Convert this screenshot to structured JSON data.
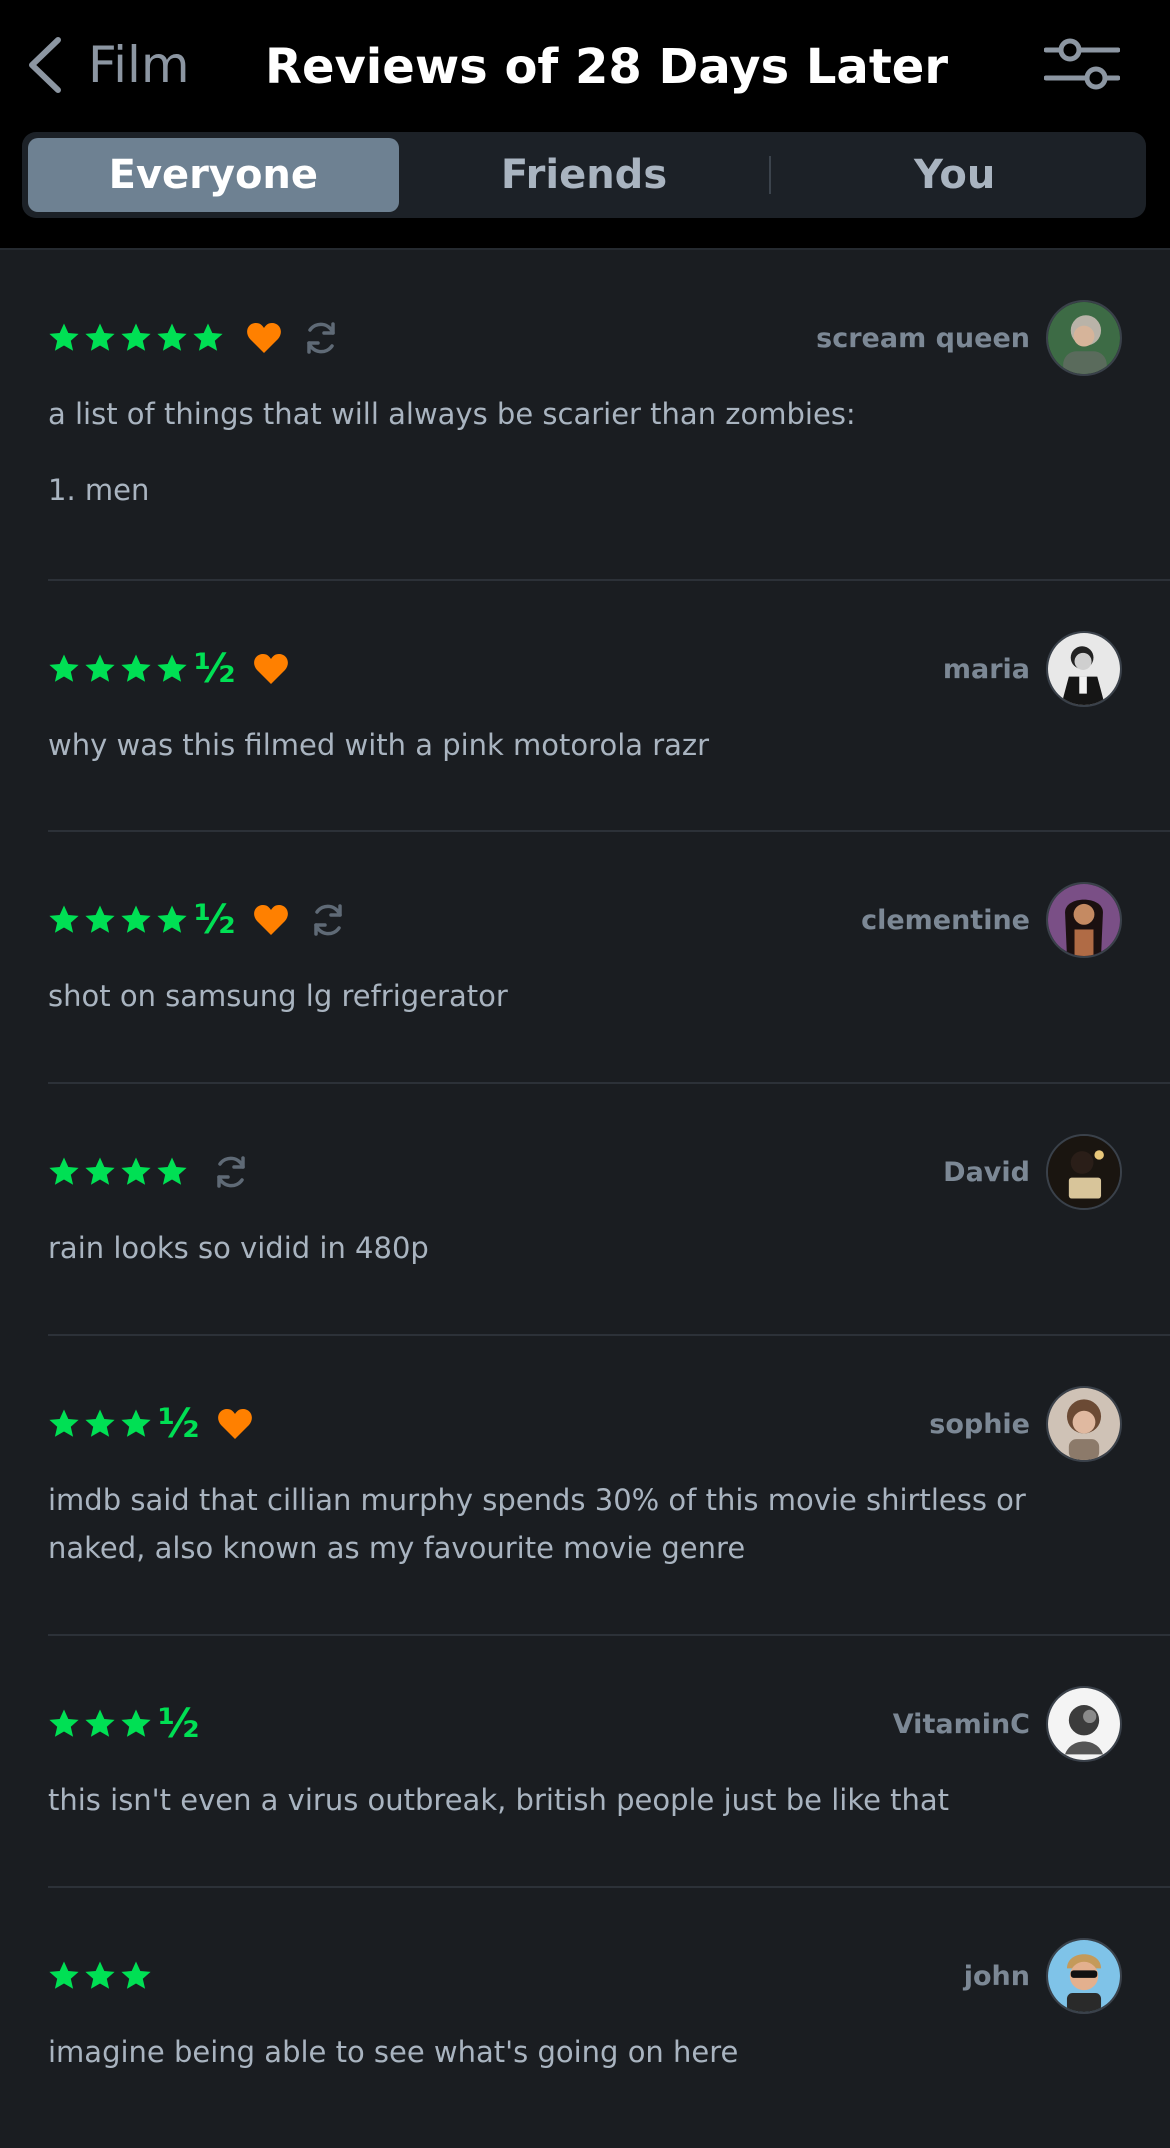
{
  "header": {
    "back_label": "Film",
    "title": "Reviews of 28 Days Later"
  },
  "tabs": [
    {
      "label": "Everyone",
      "active": true
    },
    {
      "label": "Friends",
      "active": false
    },
    {
      "label": "You",
      "active": false
    }
  ],
  "colors": {
    "star": "#00e054",
    "heart": "#ff8000",
    "accent_tab": "#6e8192"
  },
  "reviews": [
    {
      "username": "scream queen",
      "stars": 5,
      "liked": true,
      "rewatch": true,
      "lines": [
        "a list of things that will always be scarier than zombies:",
        "1. men"
      ]
    },
    {
      "username": "maria",
      "stars": 4.5,
      "liked": true,
      "rewatch": false,
      "lines": [
        "why was this filmed with a pink motorola razr"
      ]
    },
    {
      "username": "clementine",
      "stars": 4.5,
      "liked": true,
      "rewatch": true,
      "lines": [
        "shot on samsung lg refrigerator"
      ]
    },
    {
      "username": "David",
      "stars": 4,
      "liked": false,
      "rewatch": true,
      "lines": [
        "rain looks so vidid in 480p"
      ]
    },
    {
      "username": "sophie",
      "stars": 3.5,
      "liked": true,
      "rewatch": false,
      "lines": [
        "imdb said that cillian murphy spends 30% of this movie shirtless or naked, also known as my favourite movie genre"
      ]
    },
    {
      "username": "VitaminC",
      "stars": 3.5,
      "liked": false,
      "rewatch": false,
      "lines": [
        "this isn't even a virus outbreak, british people just be like that"
      ]
    },
    {
      "username": "john",
      "stars": 3,
      "liked": false,
      "rewatch": false,
      "lines": [
        "imagine being able to see what's going on here"
      ]
    }
  ]
}
